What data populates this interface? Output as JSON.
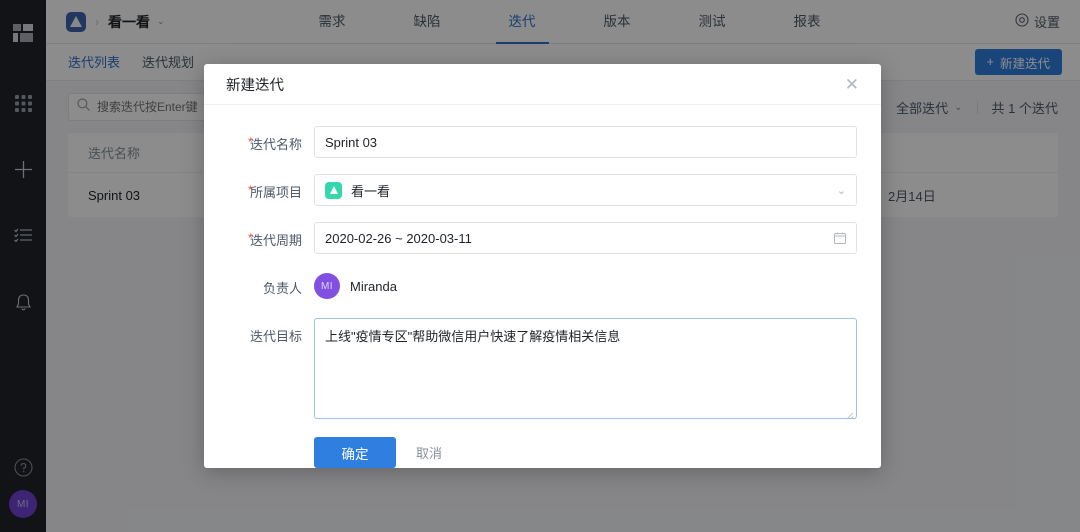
{
  "sidebar": {
    "items": [
      {
        "name": "dashboard-icon",
        "label": ""
      },
      {
        "name": "apps-grid-icon",
        "label": ""
      },
      {
        "name": "plus-icon",
        "label": ""
      },
      {
        "name": "checklist-icon",
        "label": ""
      },
      {
        "name": "bell-icon",
        "label": ""
      }
    ],
    "help_label": "?",
    "avatar_initials": "MI"
  },
  "header": {
    "breadcrumb_separator": "›",
    "project_name": "看一看",
    "caret": "⌄",
    "tabs": [
      {
        "label": "需求",
        "active": false
      },
      {
        "label": "缺陷",
        "active": false
      },
      {
        "label": "迭代",
        "active": true
      },
      {
        "label": "版本",
        "active": false
      },
      {
        "label": "测试",
        "active": false
      },
      {
        "label": "报表",
        "active": false
      }
    ],
    "settings_label": "设置"
  },
  "subnav": {
    "tabs": [
      {
        "label": "迭代列表",
        "active": true
      },
      {
        "label": "迭代规划",
        "active": false
      }
    ],
    "new_button_label": "新建迭代",
    "new_button_icon": "+"
  },
  "toolbar": {
    "search_placeholder": "搜索迭代按Enter键",
    "search_value": "",
    "filter_label": "全部迭代",
    "filter_caret": "⌄",
    "count_label": "共 1 个迭代"
  },
  "table": {
    "columns": [
      "迭代名称",
      ""
    ],
    "rows": [
      {
        "name": "Sprint 03",
        "date": "2月14日"
      }
    ]
  },
  "dialog": {
    "title": "新建迭代",
    "close_icon": "✕",
    "fields": {
      "name": {
        "label": "迭代名称",
        "value": "Sprint 03",
        "required": true
      },
      "project": {
        "label": "所属项目",
        "value": "看一看",
        "required": true,
        "caret": "⌄"
      },
      "period": {
        "label": "迭代周期",
        "value": "2020-02-26 ~ 2020-03-11",
        "required": true
      },
      "owner": {
        "label": "负责人",
        "value": "Miranda",
        "initials": "MI",
        "required": false
      },
      "goal": {
        "label": "迭代目标",
        "value": "上线\"疫情专区\"帮助微信用户快速了解疫情相关信息",
        "required": false
      }
    },
    "confirm_label": "确定",
    "cancel_label": "取消"
  },
  "colors": {
    "accent": "#2f7fe0",
    "tab_active": "#2f6fce",
    "project_icon": "#34d6ab",
    "avatar": "#8150e3",
    "required_mark": "#e8533f",
    "rail_bg": "#1f2329"
  }
}
